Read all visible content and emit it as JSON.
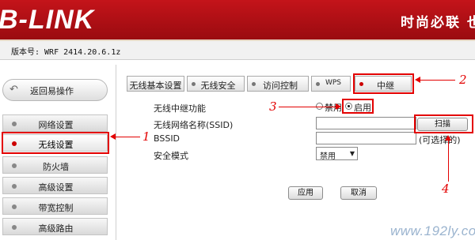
{
  "header": {
    "logo": "B-LINK",
    "slogan": "时尚必联 也"
  },
  "version_bar": {
    "text": "版本号: WRF 2414.20.6.1z"
  },
  "sidebar": {
    "back_label": "返回易操作",
    "items": [
      {
        "label": "网络设置"
      },
      {
        "label": "无线设置"
      },
      {
        "label": "防火墙"
      },
      {
        "label": "高级设置"
      },
      {
        "label": "带宽控制"
      },
      {
        "label": "高级路由"
      }
    ]
  },
  "tabs": [
    {
      "label": "无线基本设置"
    },
    {
      "label": "无线安全"
    },
    {
      "label": "访问控制"
    },
    {
      "label": "WPS"
    },
    {
      "label": "中继"
    }
  ],
  "form": {
    "repeater_label": "无线中继功能",
    "option_disable": "禁用",
    "option_enable": "启用",
    "ssid_label": "无线网络名称(SSID)",
    "ssid_value": "",
    "scan_button": "扫描",
    "bssid_label": "BSSID",
    "bssid_value": "",
    "bssid_hint": "(可选择的)",
    "security_label": "安全模式",
    "security_value": "禁用",
    "apply_button": "应用",
    "cancel_button": "取消"
  },
  "annotations": {
    "step1": "1",
    "step2": "2",
    "step3": "3",
    "step4": "4"
  },
  "watermark": "www.192ly.com",
  "colors": {
    "header_red": "#c4141a",
    "annotation_red": "#e30000",
    "active_dot": "#cc0000"
  }
}
